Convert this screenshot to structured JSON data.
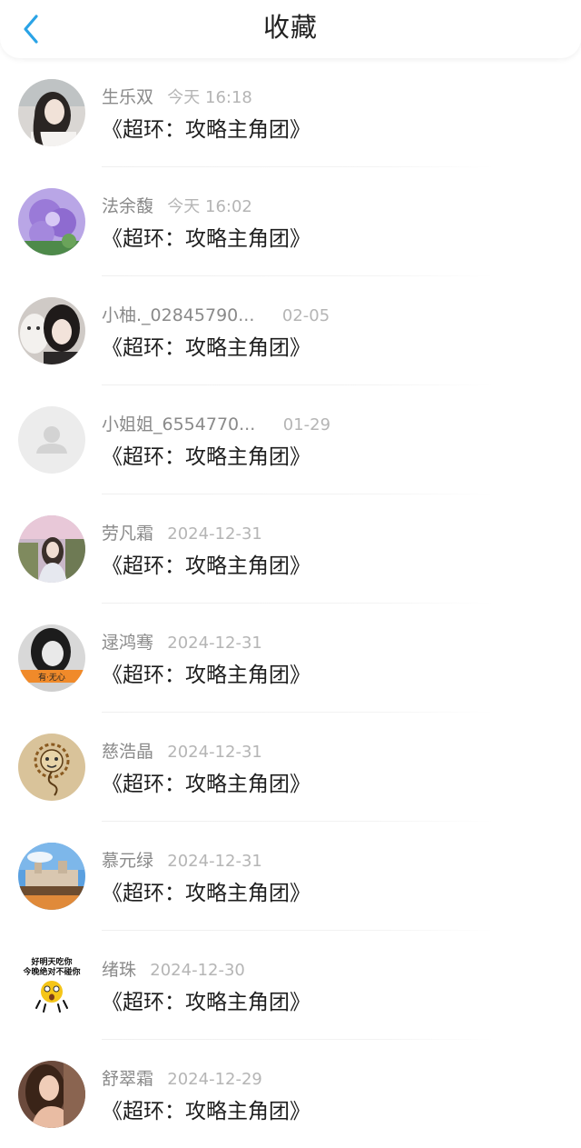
{
  "header": {
    "title": "收藏",
    "back_icon": "chevron-left-icon",
    "accent_color": "#2aa3e6"
  },
  "favorites": [
    {
      "user": "生乐双",
      "time": "今天 16:18",
      "title": "《超环：攻略主角团》",
      "avatar": "girl-photo"
    },
    {
      "user": "法余馥",
      "time": "今天 16:02",
      "title": "《超环：攻略主角团》",
      "avatar": "purple-flowers"
    },
    {
      "user": "小柚._02845790...",
      "time": "02-05",
      "title": "《超环：攻略主角团》",
      "avatar": "girl-with-cat"
    },
    {
      "user": "小姐姐_6554770...",
      "time": "01-29",
      "title": "《超环：攻略主角团》",
      "avatar": "default-person-icon"
    },
    {
      "user": "劳凡霜",
      "time": "2024-12-31",
      "title": "《超环：攻略主角团》",
      "avatar": "girl-outdoor"
    },
    {
      "user": "逯鸿骞",
      "time": "2024-12-31",
      "title": "《超环：攻略主角团》",
      "avatar": "girl-bw-banner"
    },
    {
      "user": "慈浩晶",
      "time": "2024-12-31",
      "title": "《超环：攻略主角团》",
      "avatar": "cartoon-lion"
    },
    {
      "user": "慕元绿",
      "time": "2024-12-31",
      "title": "《超环：攻略主角团》",
      "avatar": "castle-landscape"
    },
    {
      "user": "绪珠",
      "time": "2024-12-30",
      "title": "《超环：攻略主角团》",
      "avatar": "emoji-meme"
    },
    {
      "user": "舒翠霜",
      "time": "2024-12-29",
      "title": "《超环：攻略主角团》",
      "avatar": "woman-portrait"
    }
  ],
  "avatar_texts": {
    "meme_line1": "好明天吃你",
    "meme_line2": "今晚绝对不碰你",
    "banner_text": "有·无心"
  }
}
